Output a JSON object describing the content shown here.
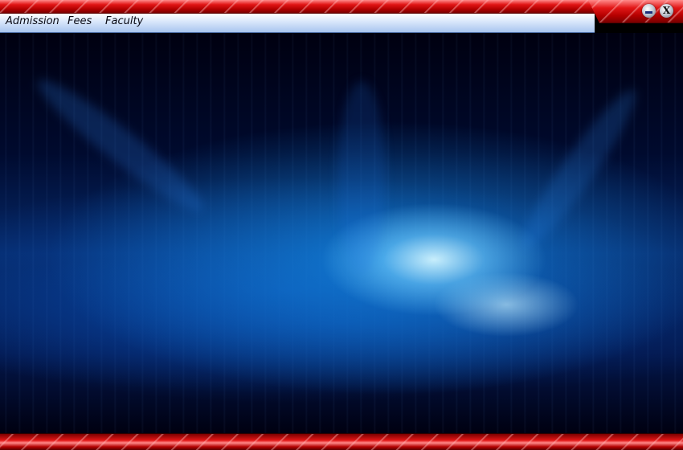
{
  "menu": {
    "items": [
      {
        "label": "Admission"
      },
      {
        "label": "Fees"
      },
      {
        "label": "Faculty"
      }
    ]
  },
  "window_controls": {
    "close_label": "X",
    "minimize_icon": "minimize-icon",
    "close_icon": "close-icon"
  },
  "theme": {
    "title_bar_color": "#d10f0f",
    "menu_bar_color": "#c9dcf7",
    "background_glow_color": "#1a8ee8",
    "background_dark_color": "#000a2e"
  }
}
